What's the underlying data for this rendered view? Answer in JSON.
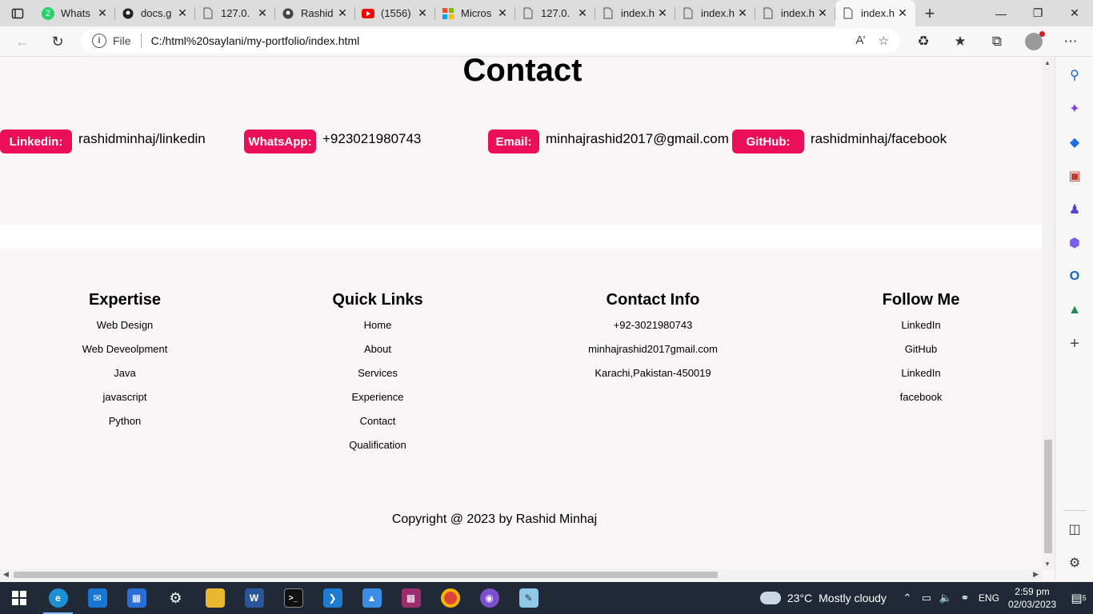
{
  "browser": {
    "tabs": [
      {
        "title": "Whats",
        "icon": "whatsapp-icon",
        "color": "#25d366",
        "badge": "2"
      },
      {
        "title": "docs.g",
        "icon": "github-icon",
        "color": "#222222"
      },
      {
        "title": "127.0.",
        "icon": "page-icon",
        "color": "#666666"
      },
      {
        "title": "Rashid",
        "icon": "github-icon",
        "color": "#444444"
      },
      {
        "title": "(1556)",
        "icon": "youtube-icon",
        "color": "#ff0000"
      },
      {
        "title": "Micros",
        "icon": "microsoft-icon",
        "color": "#f25022"
      },
      {
        "title": "127.0.",
        "icon": "page-icon",
        "color": "#666666"
      },
      {
        "title": "index.h",
        "icon": "page-icon",
        "color": "#666666"
      },
      {
        "title": "index.h",
        "icon": "page-icon",
        "color": "#666666"
      },
      {
        "title": "index.h",
        "icon": "page-icon",
        "color": "#666666"
      },
      {
        "title": "index.h",
        "icon": "page-icon",
        "color": "#666666"
      }
    ],
    "omnibox": {
      "scheme": "File",
      "url": "C:/html%20saylani/my-portfolio/index.html"
    }
  },
  "page": {
    "contact_title": "Contact",
    "contacts": [
      {
        "label": "Linkedin:",
        "value": "rashidminhaj/linkedin"
      },
      {
        "label": "WhatsApp:",
        "value": "+923021980743"
      },
      {
        "label": "Email:",
        "value": "minhajrashid2017@gmail.com"
      },
      {
        "label": "GitHub:",
        "value": "rashidminhaj/facebook"
      }
    ],
    "accent_color": "#eb0f59",
    "footer": {
      "expertise": {
        "heading": "Expertise",
        "links": [
          "Web Design",
          "Web Deveolpment",
          "Java",
          "javascript",
          "Python"
        ]
      },
      "quick_links": {
        "heading": "Quick Links",
        "links": [
          "Home",
          "About",
          "Services",
          "Experience",
          "Contact",
          "Qualification"
        ]
      },
      "contact_info": {
        "heading": "Contact Info",
        "links": [
          "+92-3021980743",
          "minhajrashid2017gmail.com",
          "Karachi,Pakistan-450019"
        ]
      },
      "follow_me": {
        "heading": "Follow Me",
        "links": [
          "LinkedIn",
          "GitHub",
          "LinkedIn",
          "facebook"
        ]
      }
    },
    "copyright": "Copyright @ 2023 by Rashid Minhaj"
  },
  "taskbar": {
    "weather": {
      "temp": "23°C",
      "condition": "Mostly cloudy"
    },
    "language": "ENG",
    "time": "2:59 pm",
    "date": "02/03/2023",
    "notifications": "5"
  }
}
